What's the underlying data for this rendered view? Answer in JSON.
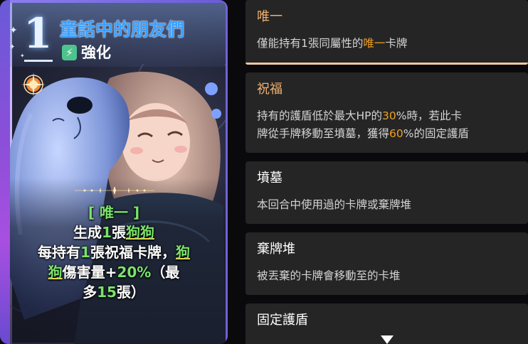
{
  "card": {
    "cost": "1",
    "title": "童話中的朋友們",
    "type_label": "強化",
    "type_icon": "lightning-bolt-icon",
    "desc": {
      "tag": "[ 唯一 ]",
      "line1_a": "生成",
      "line1_num": "1",
      "line1_b": "張",
      "line1_link": "狗狗",
      "line2_a": "每持有",
      "line2_num": "1",
      "line2_b": "張祝福卡牌，",
      "line2_link1": "狗",
      "line3_link2": "狗",
      "line3_a": "傷害量+",
      "line3_num": "20%",
      "line3_b": "（最",
      "line4_a": "多",
      "line4_num": "15",
      "line4_b": "張）"
    },
    "colors": {
      "title": "#3aa0ff",
      "green": "#7be36b",
      "yellow": "#ffd34a",
      "frame": "#8a4fd8"
    }
  },
  "keywords": [
    {
      "title": "唯一",
      "title_color": "#f0b070",
      "body_pre": "僅能持有1張同屬性的",
      "body_hl": "唯一",
      "body_post": "卡牌"
    },
    {
      "title": "祝福",
      "title_color": "#f0b070",
      "line1_pre": "持有的護盾低於最大HP的",
      "line1_hl": "30",
      "line1_post": "%時，若此卡",
      "line2_pre": "牌從手牌移動至墳墓，獲得",
      "line2_hl": "60",
      "line2_post": "%的固定護盾"
    },
    {
      "title": "墳墓",
      "title_color": "#ffffff",
      "body": "本回合中使用過的卡牌或棄牌堆"
    },
    {
      "title": "棄牌堆",
      "title_color": "#ffffff",
      "body": "被丟棄的卡牌會移動至的卡堆"
    },
    {
      "title": "固定護盾",
      "title_color": "#ffffff"
    }
  ]
}
